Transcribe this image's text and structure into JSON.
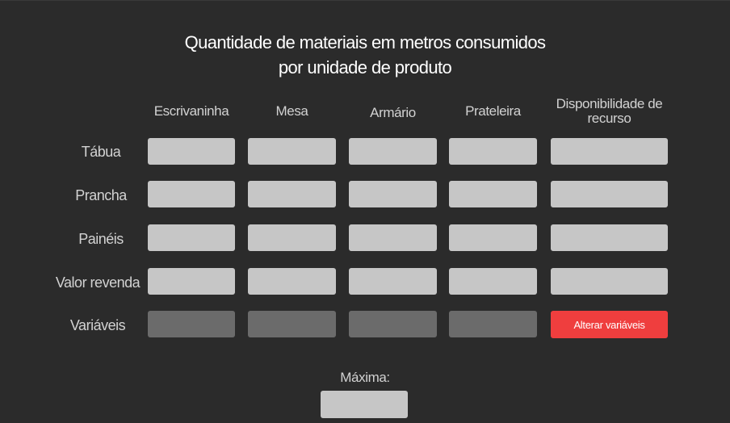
{
  "title": {
    "line1": "Quantidade de materiais em metros consumidos",
    "line2": "por unidade de produto"
  },
  "columns": [
    "Escrivaninha",
    "Mesa",
    "Armário",
    "Prateleira",
    "Disponibilidade de recurso"
  ],
  "rows": [
    "Tábua",
    "Prancha",
    "Painéis",
    "Valor revenda"
  ],
  "variables_row": {
    "label": "Variáveis",
    "button_label": "Alterar variáveis"
  },
  "maxima": {
    "label": "Máxima:",
    "value": ""
  },
  "colors": {
    "background": "#2b2b2b",
    "input": "#c6c6c6",
    "variable_input": "#6b6b6b",
    "accent": "#ef3e3e"
  }
}
